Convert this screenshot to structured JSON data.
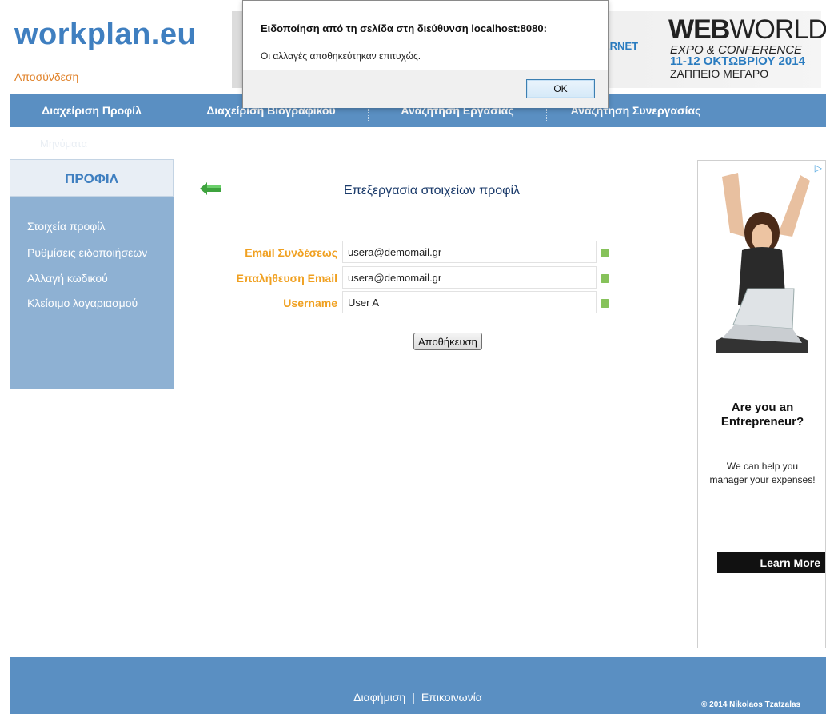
{
  "header": {
    "logo": "workplan.eu",
    "logout": "Αποσύνδεση",
    "banner": {
      "internet": "ERNET",
      "web_bold": "WEB",
      "web_normal": "WORLD",
      "expo": "EXPO & CONFERENCE",
      "dates": "11-12 ΟΚΤΩΒΡΙΟΥ 2014",
      "venue": "ΖΑΠΠΕΙΟ ΜΕΓΑΡΟ"
    }
  },
  "nav": {
    "items": [
      {
        "label": "Διαχείριση Προφίλ"
      },
      {
        "label": "Διαχείριση Βιογραφικού"
      },
      {
        "label": "Αναζήτηση Εργασίας"
      },
      {
        "label": "Αναζήτηση Συνεργασίας"
      }
    ],
    "sub_item": "Μηνύματα"
  },
  "sidebar": {
    "heading": "ΠΡΟΦΙΛ",
    "items": [
      {
        "label": "Στοιχεία προφίλ"
      },
      {
        "label": "Ρυθμίσεις ειδοποιήσεων"
      },
      {
        "label": "Αλλαγή κωδικού"
      },
      {
        "label": "Κλείσιμο λογαριασμού"
      }
    ]
  },
  "main": {
    "title": "Επεξεργασία στοιχείων προφίλ",
    "fields": [
      {
        "label": "Email Συνδέσεως",
        "value": "usera@demomail.gr"
      },
      {
        "label": "Επαλήθευση Email",
        "value": "usera@demomail.gr"
      },
      {
        "label": "Username",
        "value": "User A"
      }
    ],
    "save_label": "Αποθήκευση"
  },
  "ad": {
    "headline_line1": "Are you an",
    "headline_line2": "Entrepreneur?",
    "sub_line1": "We can help you",
    "sub_line2": "manager your expenses!",
    "button": "Learn More"
  },
  "footer": {
    "link_ad": "Διαφήμιση",
    "separator": "|",
    "link_contact": "Επικοινωνία",
    "copyright": "© 2014 Nikolaos Tzatzalas"
  },
  "alert": {
    "title": "Ειδοποίηση από τη σελίδα στη διεύθυνση localhost:8080:",
    "message": "Οι αλλαγές αποθηκεύτηκαν επιτυχώς.",
    "ok_label": "OK"
  },
  "colors": {
    "brand_blue": "#3f7fc0",
    "nav_blue": "#5a8fc2",
    "sidebar_blue": "#8eb1d3",
    "label_orange": "#f0a020",
    "logout_orange": "#e0822a"
  }
}
